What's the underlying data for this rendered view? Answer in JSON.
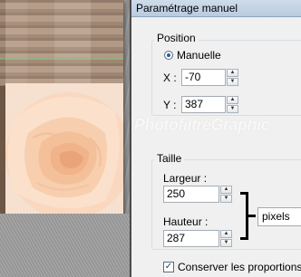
{
  "dialog": {
    "title": "Paramétrage manuel",
    "position": {
      "group_label": "Position",
      "mode_label": "Manuelle",
      "x_label": "X :",
      "x_value": "-70",
      "y_label": "Y :",
      "y_value": "387"
    },
    "size": {
      "group_label": "Taille",
      "width_label": "Largeur :",
      "width_value": "250",
      "height_label": "Hauteur :",
      "height_value": "287",
      "unit_selected": "pixels"
    },
    "keep_proportions": {
      "label": "Conserver les proportions",
      "checked": true
    }
  },
  "watermark": "PhotofiltreGraphic",
  "icons": [
    "radio-selected-icon",
    "spin-up-icon",
    "spin-down-icon",
    "link-bracket-icon",
    "checkbox-checked-icon"
  ]
}
